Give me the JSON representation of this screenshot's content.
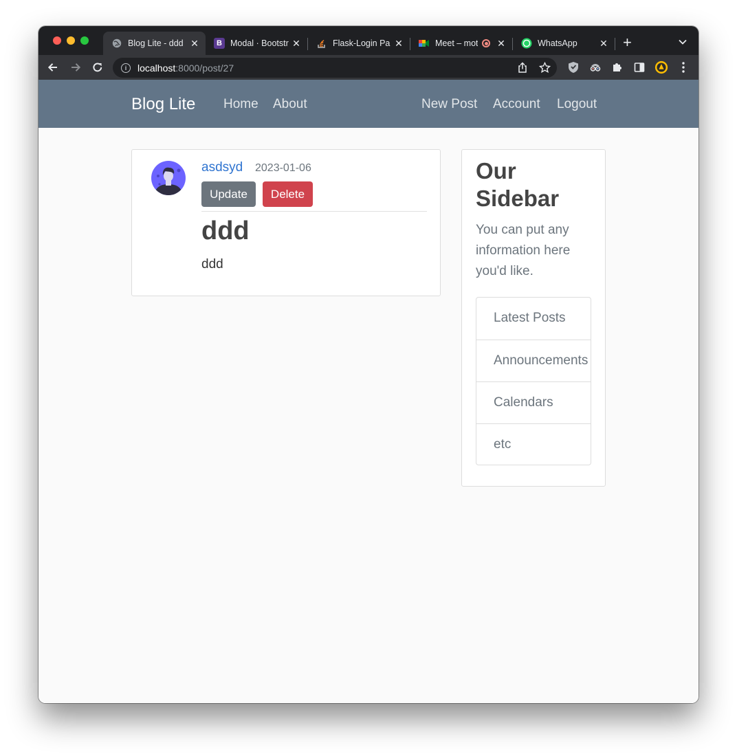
{
  "browser": {
    "tabs": [
      {
        "title": "Blog Lite - ddd",
        "icon": "globe-icon"
      },
      {
        "title": "Modal · Bootstr",
        "icon": "bootstrap-icon"
      },
      {
        "title": "Flask-Login Pa",
        "icon": "stackoverflow-icon"
      },
      {
        "title": "Meet – mot",
        "icon": "google-meet-icon"
      },
      {
        "title": "WhatsApp",
        "icon": "whatsapp-icon"
      }
    ],
    "address": {
      "host": "localhost",
      "path": ":8000/post/27"
    },
    "colors": {
      "tabstrip": "#1f2023",
      "toolbar": "#35363a",
      "omnibox": "#202124"
    }
  },
  "navbar": {
    "brand": "Blog Lite",
    "links": [
      "Home",
      "About",
      "New Post",
      "Account",
      "Logout"
    ],
    "background": "#627588"
  },
  "post": {
    "author": "asdsyd",
    "date": "2023-01-06",
    "update_label": "Update",
    "delete_label": "Delete",
    "title": "ddd",
    "content": "ddd"
  },
  "sidebar": {
    "title": "Our Sidebar",
    "text": "You can put any information here you'd like.",
    "items": [
      "Latest Posts",
      "Announcements",
      "Calendars",
      "etc"
    ]
  }
}
